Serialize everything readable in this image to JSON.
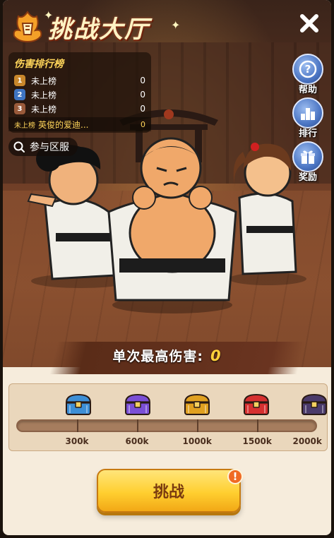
{
  "header": {
    "title": "挑战大厅"
  },
  "leaderboard": {
    "title": "伤害排行榜",
    "rows": [
      {
        "rank": "1",
        "name": "未上榜",
        "value": "0",
        "color": "#c9872b"
      },
      {
        "rank": "2",
        "name": "未上榜",
        "value": "0",
        "color": "#3e74c2"
      },
      {
        "rank": "3",
        "name": "未上榜",
        "value": "0",
        "color": "#9a5a3a"
      }
    ],
    "me": {
      "tag": "未上榜",
      "name": "英俊的爱迪...",
      "value": "0"
    }
  },
  "region_button": {
    "label": "参与区服",
    "icon": "search-icon"
  },
  "side_buttons": [
    {
      "label": "帮助",
      "icon": "help-icon"
    },
    {
      "label": "排行",
      "icon": "ranking-icon"
    },
    {
      "label": "奖励",
      "icon": "gift-icon"
    }
  ],
  "damage": {
    "label": "单次最高伤害:",
    "value": "0"
  },
  "progress": {
    "current": 0,
    "max": 2000,
    "milestones": [
      {
        "label": "300k",
        "chest": "blue-chest-icon",
        "color": "#3d8fd6"
      },
      {
        "label": "600k",
        "chest": "purple-chest-icon",
        "color": "#7a4fd6"
      },
      {
        "label": "1000k",
        "chest": "gold-chest-icon",
        "color": "#e0a020"
      },
      {
        "label": "1500k",
        "chest": "red-chest-icon",
        "color": "#d63030"
      },
      {
        "label": "2000k",
        "chest": "dark-chest-icon",
        "color": "#4a3a6a"
      }
    ]
  },
  "challenge_button": {
    "label": "挑战",
    "alert": "!"
  },
  "colors": {
    "accent": "#ffcf3a",
    "panel": "#f6ecdc"
  }
}
